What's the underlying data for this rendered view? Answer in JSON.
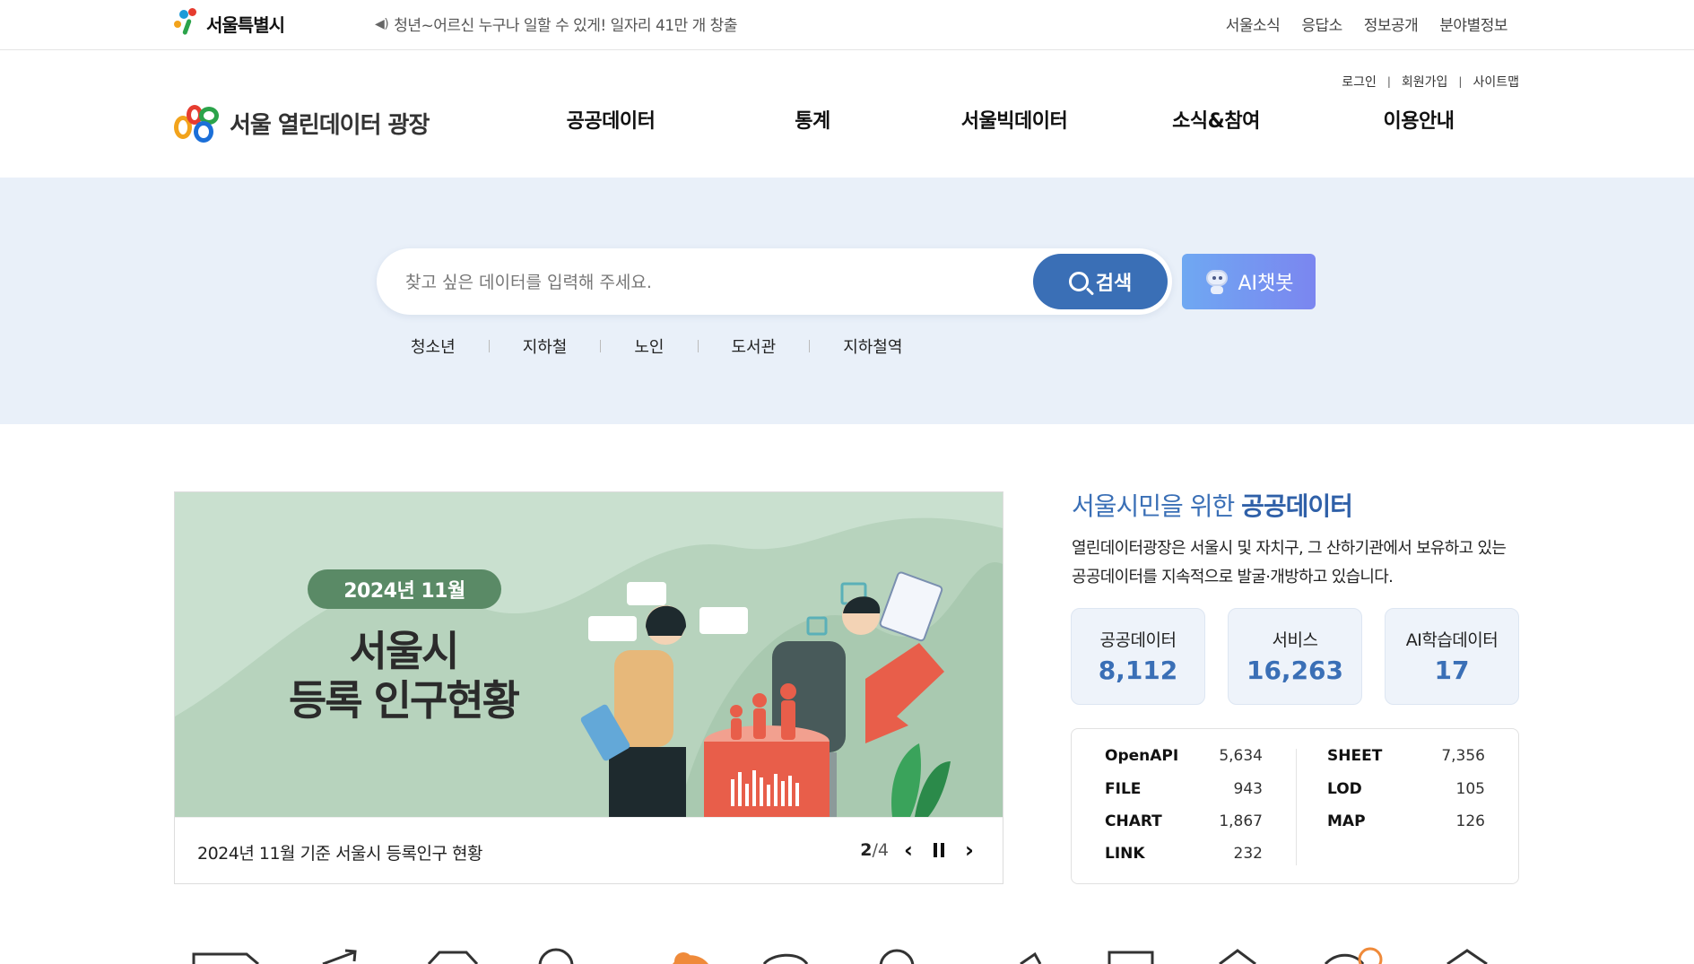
{
  "topbar": {
    "seoul_logo": "서울특별시",
    "notice": "청년~어르신 누구나 일할 수 있게! 일자리 41만 개 창출",
    "links": [
      "서울소식",
      "응답소",
      "정보공개",
      "분야별정보"
    ]
  },
  "header": {
    "member_links": [
      "로그인",
      "회원가입",
      "사이트맵"
    ],
    "site_logo": "서울 열린데이터 광장",
    "nav": [
      "공공데이터",
      "통계",
      "서울빅데이터",
      "소식&참여",
      "이용안내"
    ]
  },
  "search": {
    "placeholder": "찾고 싶은 데이터를 입력해 주세요.",
    "button_label": "검색",
    "ai_button_label": "AI챗봇",
    "keywords": [
      "청소년",
      "지하철",
      "노인",
      "도서관",
      "지하철역"
    ]
  },
  "banner": {
    "pill": "2024년 11월",
    "headline_line1": "서울시",
    "headline_line2": "등록 인구현황",
    "caption": "2024년 11월 기준 서울시 등록인구 현황",
    "current": "2",
    "total": "/4"
  },
  "stats": {
    "title_prefix": "서울시민을 위한 ",
    "title_strong": "공공데이터",
    "description": "열린데이터광장은 서울시 및 자치구, 그 산하기관에서 보유하고 있는 공공데이터를 지속적으로 발굴·개방하고 있습니다.",
    "cards": [
      {
        "label": "공공데이터",
        "value": "8,112"
      },
      {
        "label": "서비스",
        "value": "16,263"
      },
      {
        "label": "AI학습데이터",
        "value": "17"
      }
    ],
    "types_left": [
      {
        "key": "OpenAPI",
        "value": "5,634"
      },
      {
        "key": "FILE",
        "value": "943"
      },
      {
        "key": "CHART",
        "value": "1,867"
      },
      {
        "key": "LINK",
        "value": "232"
      }
    ],
    "types_right": [
      {
        "key": "SHEET",
        "value": "7,356"
      },
      {
        "key": "LOD",
        "value": "105"
      },
      {
        "key": "MAP",
        "value": "126"
      }
    ]
  },
  "colors": {
    "primary": "#3a6fb6",
    "band": "#e9f0f9",
    "banner_bg": "#c9e0cf",
    "pill": "#5a8a66"
  }
}
